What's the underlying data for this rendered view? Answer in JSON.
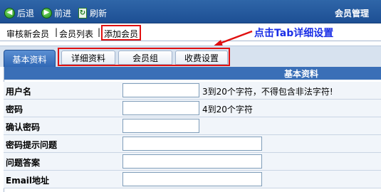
{
  "toolbar": {
    "back_label": "后退",
    "forward_label": "前进",
    "refresh_label": "刷新",
    "title": "会员管理"
  },
  "subnav": {
    "items": [
      "审核新会员",
      "会员列表",
      "添加会员"
    ],
    "separator": "|"
  },
  "annotation": {
    "text": "点击Tab详细设置",
    "color": "#1a2ee6",
    "highlight_color": "#e01010"
  },
  "tabs": {
    "active": "基本资料",
    "others": [
      "详细资料",
      "会员组",
      "收费设置"
    ]
  },
  "form": {
    "header": "基本资料",
    "rows": [
      {
        "label": "用户名",
        "value": "",
        "hint": "3到20个字符，不得包含非法字符!"
      },
      {
        "label": "密码",
        "value": "",
        "hint": "4到20个字符"
      },
      {
        "label": "确认密码",
        "value": "",
        "hint": ""
      },
      {
        "label": "密码提示问题",
        "value": "",
        "hint": ""
      },
      {
        "label": "问题答案",
        "value": "",
        "hint": ""
      },
      {
        "label": "Email地址",
        "value": "",
        "hint": ""
      }
    ]
  }
}
